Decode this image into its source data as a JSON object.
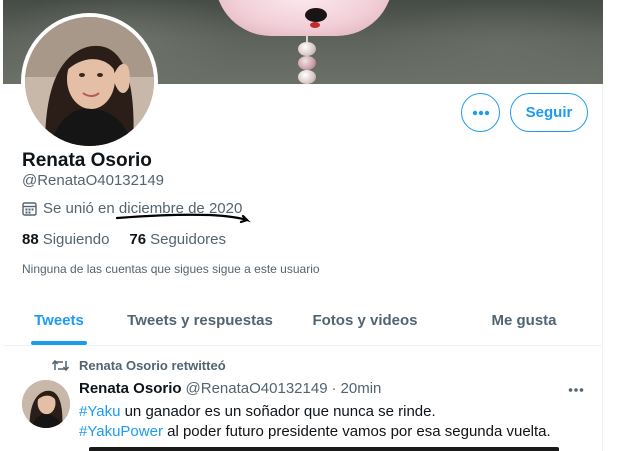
{
  "profile": {
    "name": "Renata Osorio",
    "handle": "@RenataO40132149",
    "joined": "Se unió en diciembre de 2020",
    "following_count": "88",
    "following_label": "Siguiendo",
    "followers_count": "76",
    "followers_label": "Seguidores",
    "followers_you_know": "Ninguna de las cuentas que sigues sigue a este usuario"
  },
  "actions": {
    "more_icon": "more-horizontal-icon",
    "follow_label": "Seguir"
  },
  "tabs": [
    {
      "label": "Tweets",
      "active": true
    },
    {
      "label": "Tweets y respuestas",
      "active": false
    },
    {
      "label": "Fotos y videos",
      "active": false
    },
    {
      "label": "Me gusta",
      "active": false
    }
  ],
  "tweet": {
    "retweet_label": "Renata Osorio retwitteó",
    "author": "Renata Osorio",
    "handle": "@RenataO40132149",
    "separator": "·",
    "time": "20min",
    "line1_hashtag": "#Yaku",
    "line1_text": " un ganador es un soñador que nunca se rinde.",
    "line2_hashtag": "#YakuPower",
    "line2_text": " al poder futuro presidente vamos por esa segunda vuelta."
  },
  "colors": {
    "accent": "#1d9bf0",
    "text_primary": "#0f1419",
    "text_secondary": "#536471",
    "annotation_ink": "#000000"
  }
}
